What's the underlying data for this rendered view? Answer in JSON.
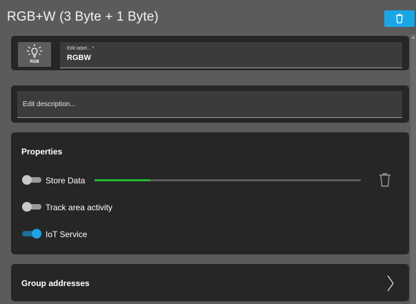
{
  "header": {
    "title": "RGB+W (3 Byte + 1 Byte)",
    "delete_icon": "trash-icon",
    "accent": "#1aa7e6"
  },
  "identity": {
    "icon": "lightbulb-icon",
    "icon_caption": "RGB",
    "label_field": {
      "label": "Edit label... *",
      "value": "RGBW"
    }
  },
  "description": {
    "placeholder": "Edit description..."
  },
  "properties": {
    "title": "Properties",
    "items": [
      {
        "label": "Store Data",
        "enabled": false
      },
      {
        "label": "Track area activity",
        "enabled": false
      },
      {
        "label": "IoT Service",
        "enabled": true
      }
    ],
    "store_data_progress": 0.21,
    "progress_color": "#25b82d",
    "toggle_on_color": "#1ea2e0"
  },
  "group_addresses": {
    "title": "Group addresses",
    "icon": "chevron-right-icon"
  }
}
